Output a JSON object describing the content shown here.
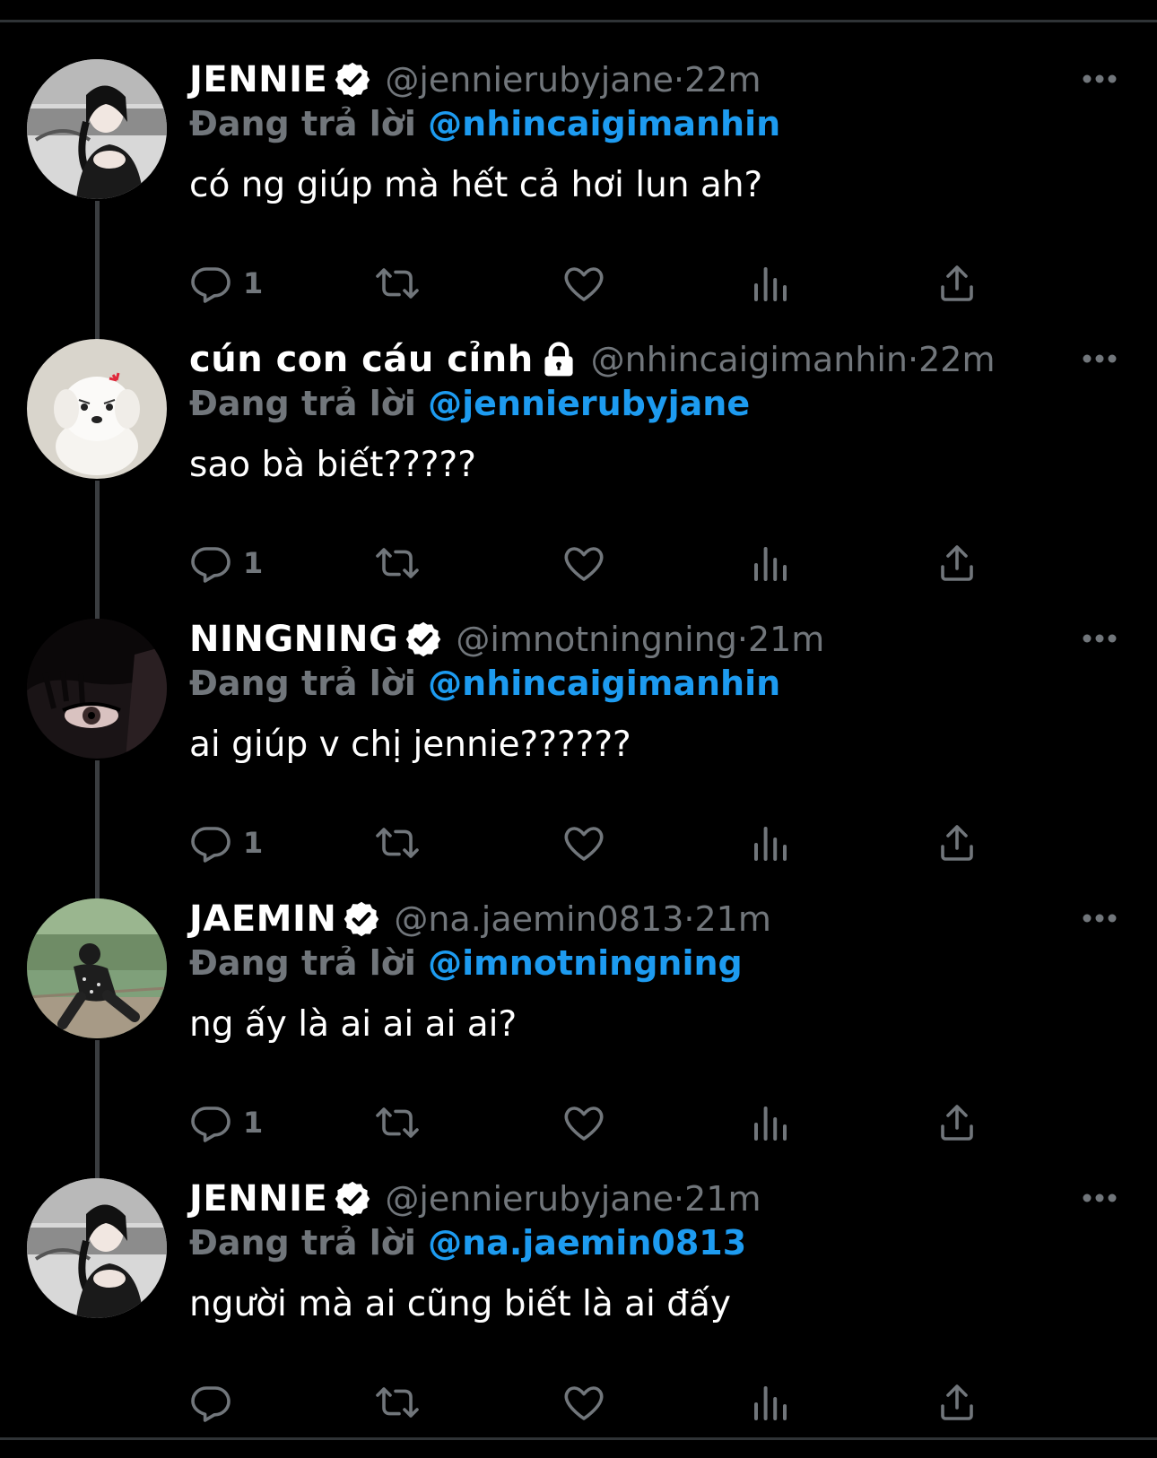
{
  "tweets": [
    {
      "name": "JENNIE",
      "badge": "verified-check",
      "handle": "@jennierubyjane",
      "time": "22m",
      "replying_label": "Đang trả lời",
      "replying_to": "@nhincaigimanhin",
      "text": "có ng giúp mà hết cả hơi lun ah?",
      "reply_count": "1",
      "avatar": "jennie-avatar"
    },
    {
      "name": "cún con cáu cỉnh",
      "badge": "lock",
      "handle": "@nhincaigimanhin",
      "time": "22m",
      "replying_label": "Đang trả lời",
      "replying_to": "@jennierubyjane",
      "text": "sao bà biết?????",
      "reply_count": "1",
      "avatar": "puppy-avatar"
    },
    {
      "name": "NINGNING",
      "badge": "verified-check",
      "handle": "@imnotningning",
      "time": "21m",
      "replying_label": "Đang trả lời",
      "replying_to": "@nhincaigimanhin",
      "text": "ai giúp v chị jennie??????",
      "reply_count": "1",
      "avatar": "ningning-avatar"
    },
    {
      "name": "JAEMIN",
      "badge": "verified-check",
      "handle": "@na.jaemin0813",
      "time": "21m",
      "replying_label": "Đang trả lời",
      "replying_to": "@imnotningning",
      "text": "ng ấy là ai ai ai ai?",
      "reply_count": "1",
      "avatar": "jaemin-avatar"
    },
    {
      "name": "JENNIE",
      "badge": "verified-check",
      "handle": "@jennierubyjane",
      "time": "21m",
      "replying_label": "Đang trả lời",
      "replying_to": "@na.jaemin0813",
      "text": "người mà ai cũng biết là ai đấy",
      "reply_count": "",
      "avatar": "jennie-avatar"
    }
  ],
  "separator": " · ",
  "icons": [
    "reply-icon",
    "retweet-icon",
    "like-icon",
    "views-icon",
    "share-icon",
    "more-icon"
  ],
  "colors": {
    "background": "#000000",
    "text": "#ffffff",
    "muted": "#71767b",
    "link": "#1d9bf0"
  }
}
